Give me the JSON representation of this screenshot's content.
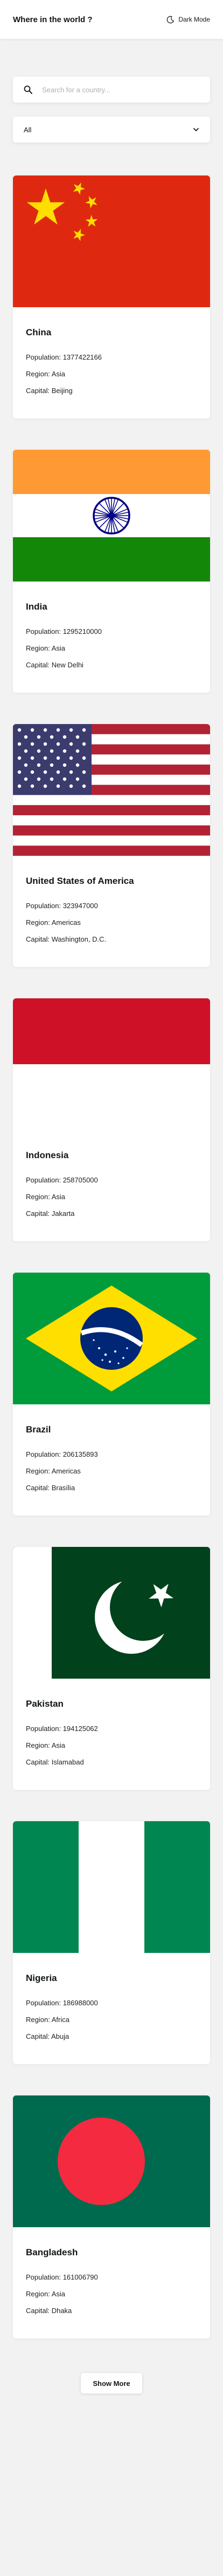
{
  "header": {
    "title": "Where in the world ?",
    "dark_mode_label": "Dark Mode",
    "icon": "moon-icon"
  },
  "search": {
    "placeholder": "Search for a country...",
    "value": "",
    "icon": "search-icon"
  },
  "filter": {
    "selected": "All",
    "icon": "chevron-down-icon"
  },
  "labels": {
    "population": "Population:",
    "region": "Region:",
    "capital": "Capital:"
  },
  "countries": [
    {
      "name": "China",
      "population": "1377422166",
      "region": "Asia",
      "capital": "Beijing",
      "flag": "china-flag"
    },
    {
      "name": "India",
      "population": "1295210000",
      "region": "Asia",
      "capital": "New Delhi",
      "flag": "india-flag"
    },
    {
      "name": "United States of America",
      "population": "323947000",
      "region": "Americas",
      "capital": "Washington, D.C.",
      "flag": "usa-flag"
    },
    {
      "name": "Indonesia",
      "population": "258705000",
      "region": "Asia",
      "capital": "Jakarta",
      "flag": "indonesia-flag"
    },
    {
      "name": "Brazil",
      "population": "206135893",
      "region": "Americas",
      "capital": "Brasília",
      "flag": "brazil-flag"
    },
    {
      "name": "Pakistan",
      "population": "194125062",
      "region": "Asia",
      "capital": "Islamabad",
      "flag": "pakistan-flag"
    },
    {
      "name": "Nigeria",
      "population": "186988000",
      "region": "Africa",
      "capital": "Abuja",
      "flag": "nigeria-flag"
    },
    {
      "name": "Bangladesh",
      "population": "161006790",
      "region": "Asia",
      "capital": "Dhaka",
      "flag": "bangladesh-flag"
    }
  ],
  "show_more_label": "Show More"
}
